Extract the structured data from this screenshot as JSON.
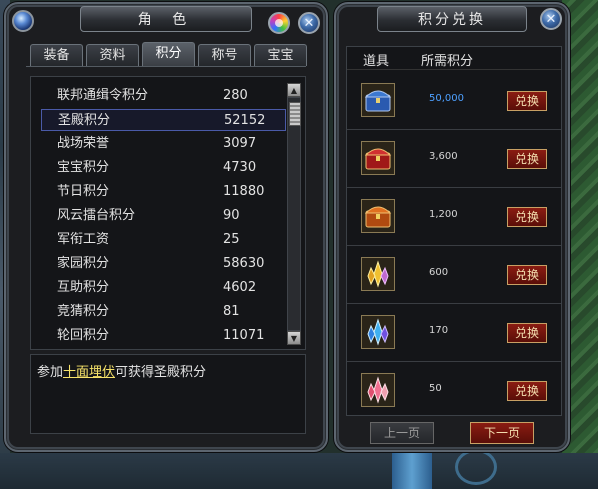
{
  "character_window": {
    "title": "角 色",
    "tabs": [
      {
        "label": "装备",
        "active": false
      },
      {
        "label": "资料",
        "active": false
      },
      {
        "label": "积分",
        "active": true
      },
      {
        "label": "称号",
        "active": false
      },
      {
        "label": "宝宝",
        "active": false
      }
    ],
    "scores": [
      {
        "name": "联邦通缉令积分",
        "value": "280",
        "selected": false
      },
      {
        "name": "圣殿积分",
        "value": "52152",
        "selected": true
      },
      {
        "name": "战场荣誉",
        "value": "3097",
        "selected": false
      },
      {
        "name": "宝宝积分",
        "value": "4730",
        "selected": false
      },
      {
        "name": "节日积分",
        "value": "11880",
        "selected": false
      },
      {
        "name": "风云擂台积分",
        "value": "90",
        "selected": false
      },
      {
        "name": "军衔工资",
        "value": "25",
        "selected": false
      },
      {
        "name": "家园积分",
        "value": "58630",
        "selected": false
      },
      {
        "name": "互助积分",
        "value": "4602",
        "selected": false
      },
      {
        "name": "竞猜积分",
        "value": "81",
        "selected": false
      },
      {
        "name": "轮回积分",
        "value": "11071",
        "selected": false
      }
    ],
    "hint": {
      "prefix": "参加",
      "link": "十面埋伏",
      "suffix": "可获得圣殿积分"
    }
  },
  "shop_window": {
    "title": "积分兑换",
    "header": {
      "item_col": "道具",
      "cost_col": "所需积分"
    },
    "items": [
      {
        "icon": "blue-treasure-chest-icon",
        "cost": "50,000",
        "highlight": true,
        "button": "兑换"
      },
      {
        "icon": "red-treasure-chest-icon",
        "cost": "3,600",
        "highlight": false,
        "button": "兑换"
      },
      {
        "icon": "orange-treasure-chest-icon",
        "cost": "1,200",
        "highlight": false,
        "button": "兑换"
      },
      {
        "icon": "golden-crystal-icon",
        "cost": "600",
        "highlight": false,
        "button": "兑换"
      },
      {
        "icon": "blue-crystal-icon",
        "cost": "170",
        "highlight": false,
        "button": "兑换"
      },
      {
        "icon": "pink-crystal-icon",
        "cost": "50",
        "highlight": false,
        "button": "兑换"
      }
    ],
    "prev_page": "上一页",
    "next_page": "下一页"
  },
  "colors": {
    "selected_border": "#4a5aa8",
    "hint_link": "#f7e36a",
    "cost_highlight": "#4ea0ff",
    "button_red": "#8a1c12"
  }
}
